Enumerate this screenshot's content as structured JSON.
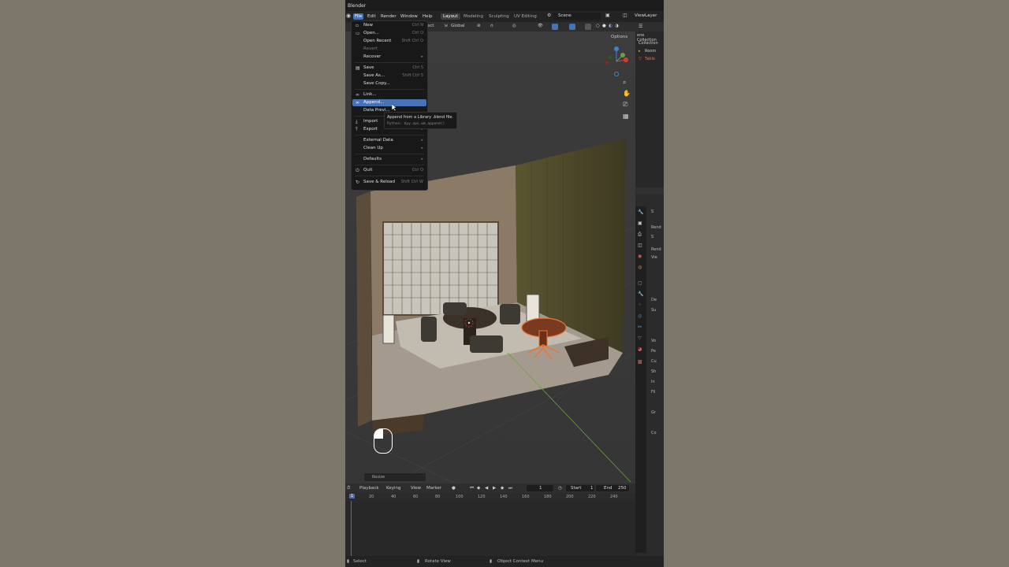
{
  "app": {
    "title": "Blender"
  },
  "menubar": {
    "items": [
      "File",
      "Edit",
      "Render",
      "Window",
      "Help"
    ],
    "workspaces": [
      "Layout",
      "Modeling",
      "Sculpting",
      "UV Editing"
    ],
    "scene": "Scene",
    "view_layer": "ViewLayer"
  },
  "viewport": {
    "orientation": "Global",
    "options_label": "Options",
    "resize_label": "Resize",
    "behind_menu_fragment": "ect"
  },
  "file_menu": {
    "items": [
      {
        "label": "New",
        "shortcut": "Ctrl N",
        "icon": "new-file-icon",
        "arrow": true
      },
      {
        "label": "Open...",
        "shortcut": "Ctrl O",
        "icon": "folder-icon"
      },
      {
        "label": "Open Recent",
        "shortcut": "Shift Ctrl O",
        "arrow": true
      },
      {
        "label": "Revert",
        "disabled": true
      },
      {
        "label": "Recover",
        "arrow": true
      },
      {
        "label": "Save",
        "shortcut": "Ctrl S",
        "icon": "save-icon"
      },
      {
        "label": "Save As...",
        "shortcut": "Shift Ctrl S"
      },
      {
        "label": "Save Copy..."
      },
      {
        "label": "Link...",
        "icon": "link-icon"
      },
      {
        "label": "Append...",
        "icon": "append-icon",
        "highlighted": true
      },
      {
        "label": "Data Previ..."
      },
      {
        "label": "Import",
        "icon": "import-icon",
        "arrow": true
      },
      {
        "label": "Export",
        "icon": "export-icon",
        "arrow": true
      },
      {
        "label": "External Data",
        "arrow": true
      },
      {
        "label": "Clean Up",
        "arrow": true
      },
      {
        "label": "Defaults",
        "arrow": true
      },
      {
        "label": "Quit",
        "shortcut": "Ctrl Q",
        "icon": "power-icon"
      },
      {
        "label": "Save & Reload",
        "shortcut": "Shift Ctrl W",
        "icon": "reload-icon"
      }
    ]
  },
  "tooltip": {
    "text": "Append from a Library .blend file.",
    "python": "Python: bpy.ops.wm.append()"
  },
  "outliner": {
    "rows": [
      "ene Collection",
      "Collection",
      "Room",
      "Table"
    ]
  },
  "properties": {
    "rows": [
      "Rend",
      "Vie",
      "S",
      "De",
      "Su",
      "Vo",
      "Pe",
      "Cu",
      "Sh",
      "In",
      "Fil",
      "Gr",
      "Co"
    ]
  },
  "timeline": {
    "menu": [
      "Playback",
      "Keying",
      "View",
      "Marker"
    ],
    "current_frame": "1",
    "start_label": "Start",
    "start": "1",
    "end_label": "End",
    "end": "250",
    "ruler_marks": [
      "1",
      "20",
      "40",
      "60",
      "80",
      "100",
      "120",
      "140",
      "160",
      "180",
      "200",
      "220",
      "240"
    ]
  },
  "statusbar": {
    "items": [
      "Select",
      "Rotate View",
      "Object Context Menu"
    ]
  },
  "colors": {
    "accent": "#4772b3",
    "selection_orange": "#e8773c",
    "axis_green": "#6aa23a"
  }
}
